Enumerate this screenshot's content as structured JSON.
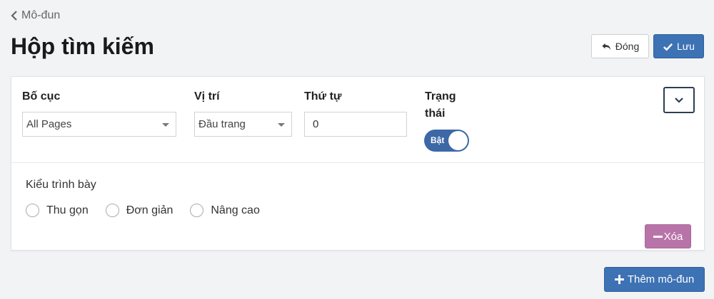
{
  "header": {
    "back_label": "Mô-đun",
    "title": "Hộp tìm kiếm",
    "close_label": "Đóng",
    "save_label": "Lưu"
  },
  "module_card": {
    "layout_field": {
      "label": "Bố cục",
      "value": "All Pages"
    },
    "position_field": {
      "label": "Vị trí",
      "value": "Đầu trang"
    },
    "order_field": {
      "label": "Thứ tự",
      "value": "0"
    },
    "status_field": {
      "label_line1": "Trạng",
      "label_line2": "thái",
      "toggle_label": "Bật",
      "on": true
    },
    "display_style": {
      "label": "Kiểu trình bày",
      "options": [
        {
          "label": "Thu gọn",
          "selected": false
        },
        {
          "label": "Đơn giản",
          "selected": false
        },
        {
          "label": "Nâng cao",
          "selected": false
        }
      ]
    },
    "delete_label": "Xóa"
  },
  "footer": {
    "add_module_label": "Thêm mô-đun"
  },
  "colors": {
    "primary": "#3d72b4",
    "toggle_on": "#3d68a6",
    "danger": "#b874a8",
    "background": "#f2f3f5"
  },
  "icons": {
    "back": "chevron-left-icon",
    "close": "undo-arrow-icon",
    "save": "check-icon",
    "collapse": "chevron-down-icon",
    "delete": "minus-icon",
    "add": "plus-icon"
  }
}
